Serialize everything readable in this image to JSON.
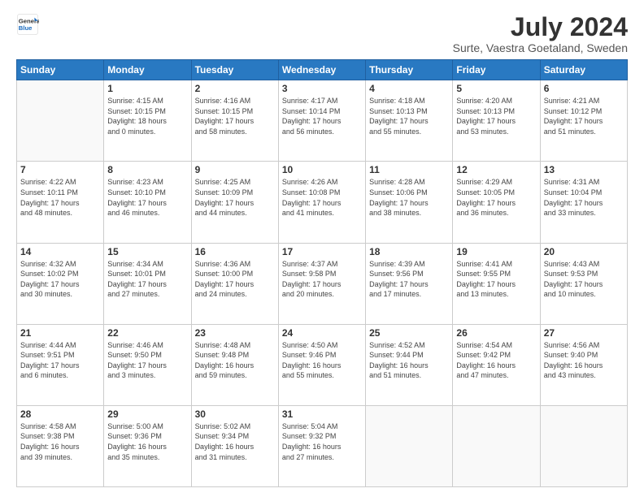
{
  "logo": {
    "line1": "General",
    "line2": "Blue"
  },
  "title": "July 2024",
  "location": "Surte, Vaestra Goetaland, Sweden",
  "weekdays": [
    "Sunday",
    "Monday",
    "Tuesday",
    "Wednesday",
    "Thursday",
    "Friday",
    "Saturday"
  ],
  "weeks": [
    [
      {
        "day": "",
        "info": ""
      },
      {
        "day": "1",
        "info": "Sunrise: 4:15 AM\nSunset: 10:15 PM\nDaylight: 18 hours\nand 0 minutes."
      },
      {
        "day": "2",
        "info": "Sunrise: 4:16 AM\nSunset: 10:15 PM\nDaylight: 17 hours\nand 58 minutes."
      },
      {
        "day": "3",
        "info": "Sunrise: 4:17 AM\nSunset: 10:14 PM\nDaylight: 17 hours\nand 56 minutes."
      },
      {
        "day": "4",
        "info": "Sunrise: 4:18 AM\nSunset: 10:13 PM\nDaylight: 17 hours\nand 55 minutes."
      },
      {
        "day": "5",
        "info": "Sunrise: 4:20 AM\nSunset: 10:13 PM\nDaylight: 17 hours\nand 53 minutes."
      },
      {
        "day": "6",
        "info": "Sunrise: 4:21 AM\nSunset: 10:12 PM\nDaylight: 17 hours\nand 51 minutes."
      }
    ],
    [
      {
        "day": "7",
        "info": "Sunrise: 4:22 AM\nSunset: 10:11 PM\nDaylight: 17 hours\nand 48 minutes."
      },
      {
        "day": "8",
        "info": "Sunrise: 4:23 AM\nSunset: 10:10 PM\nDaylight: 17 hours\nand 46 minutes."
      },
      {
        "day": "9",
        "info": "Sunrise: 4:25 AM\nSunset: 10:09 PM\nDaylight: 17 hours\nand 44 minutes."
      },
      {
        "day": "10",
        "info": "Sunrise: 4:26 AM\nSunset: 10:08 PM\nDaylight: 17 hours\nand 41 minutes."
      },
      {
        "day": "11",
        "info": "Sunrise: 4:28 AM\nSunset: 10:06 PM\nDaylight: 17 hours\nand 38 minutes."
      },
      {
        "day": "12",
        "info": "Sunrise: 4:29 AM\nSunset: 10:05 PM\nDaylight: 17 hours\nand 36 minutes."
      },
      {
        "day": "13",
        "info": "Sunrise: 4:31 AM\nSunset: 10:04 PM\nDaylight: 17 hours\nand 33 minutes."
      }
    ],
    [
      {
        "day": "14",
        "info": "Sunrise: 4:32 AM\nSunset: 10:02 PM\nDaylight: 17 hours\nand 30 minutes."
      },
      {
        "day": "15",
        "info": "Sunrise: 4:34 AM\nSunset: 10:01 PM\nDaylight: 17 hours\nand 27 minutes."
      },
      {
        "day": "16",
        "info": "Sunrise: 4:36 AM\nSunset: 10:00 PM\nDaylight: 17 hours\nand 24 minutes."
      },
      {
        "day": "17",
        "info": "Sunrise: 4:37 AM\nSunset: 9:58 PM\nDaylight: 17 hours\nand 20 minutes."
      },
      {
        "day": "18",
        "info": "Sunrise: 4:39 AM\nSunset: 9:56 PM\nDaylight: 17 hours\nand 17 minutes."
      },
      {
        "day": "19",
        "info": "Sunrise: 4:41 AM\nSunset: 9:55 PM\nDaylight: 17 hours\nand 13 minutes."
      },
      {
        "day": "20",
        "info": "Sunrise: 4:43 AM\nSunset: 9:53 PM\nDaylight: 17 hours\nand 10 minutes."
      }
    ],
    [
      {
        "day": "21",
        "info": "Sunrise: 4:44 AM\nSunset: 9:51 PM\nDaylight: 17 hours\nand 6 minutes."
      },
      {
        "day": "22",
        "info": "Sunrise: 4:46 AM\nSunset: 9:50 PM\nDaylight: 17 hours\nand 3 minutes."
      },
      {
        "day": "23",
        "info": "Sunrise: 4:48 AM\nSunset: 9:48 PM\nDaylight: 16 hours\nand 59 minutes."
      },
      {
        "day": "24",
        "info": "Sunrise: 4:50 AM\nSunset: 9:46 PM\nDaylight: 16 hours\nand 55 minutes."
      },
      {
        "day": "25",
        "info": "Sunrise: 4:52 AM\nSunset: 9:44 PM\nDaylight: 16 hours\nand 51 minutes."
      },
      {
        "day": "26",
        "info": "Sunrise: 4:54 AM\nSunset: 9:42 PM\nDaylight: 16 hours\nand 47 minutes."
      },
      {
        "day": "27",
        "info": "Sunrise: 4:56 AM\nSunset: 9:40 PM\nDaylight: 16 hours\nand 43 minutes."
      }
    ],
    [
      {
        "day": "28",
        "info": "Sunrise: 4:58 AM\nSunset: 9:38 PM\nDaylight: 16 hours\nand 39 minutes."
      },
      {
        "day": "29",
        "info": "Sunrise: 5:00 AM\nSunset: 9:36 PM\nDaylight: 16 hours\nand 35 minutes."
      },
      {
        "day": "30",
        "info": "Sunrise: 5:02 AM\nSunset: 9:34 PM\nDaylight: 16 hours\nand 31 minutes."
      },
      {
        "day": "31",
        "info": "Sunrise: 5:04 AM\nSunset: 9:32 PM\nDaylight: 16 hours\nand 27 minutes."
      },
      {
        "day": "",
        "info": ""
      },
      {
        "day": "",
        "info": ""
      },
      {
        "day": "",
        "info": ""
      }
    ]
  ]
}
